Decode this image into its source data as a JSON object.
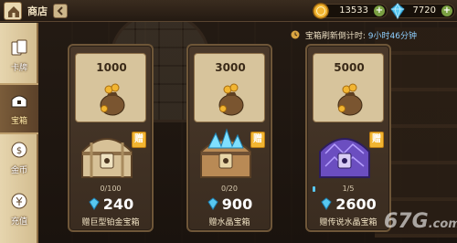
{
  "header": {
    "title": "商店",
    "gold": "13533",
    "gems": "7720",
    "plus_symbol": "+"
  },
  "sidebar": {
    "items": [
      {
        "label": "卡牌",
        "icon": "cards-icon",
        "active": false
      },
      {
        "label": "宝箱",
        "icon": "chest-icon",
        "active": true
      },
      {
        "label": "金币",
        "icon": "coin-icon",
        "active": false
      },
      {
        "label": "充值",
        "icon": "recharge-icon",
        "active": false
      }
    ]
  },
  "refresh": {
    "label": "宝箱刷新倒计时:",
    "time": "9小时46分钟"
  },
  "offers": [
    {
      "gold_amount": "1000",
      "gift_badge": "赠",
      "progress_text": "0/100",
      "progress": 0.0,
      "cost": "240",
      "name": "赠巨型铂金宝箱"
    },
    {
      "gold_amount": "3000",
      "gift_badge": "赠",
      "progress_text": "0/20",
      "progress": 0.0,
      "cost": "900",
      "name": "赠水晶宝箱"
    },
    {
      "gold_amount": "5000",
      "gift_badge": "赠",
      "progress_text": "1/5",
      "progress": 0.2,
      "cost": "2600",
      "name": "赠传说水晶宝箱"
    }
  ],
  "watermark": {
    "text": "67G",
    "suffix": ".com"
  },
  "colors": {
    "gem": "#58c8f0",
    "gold": "#f2b531",
    "panel": "#4a392a"
  }
}
